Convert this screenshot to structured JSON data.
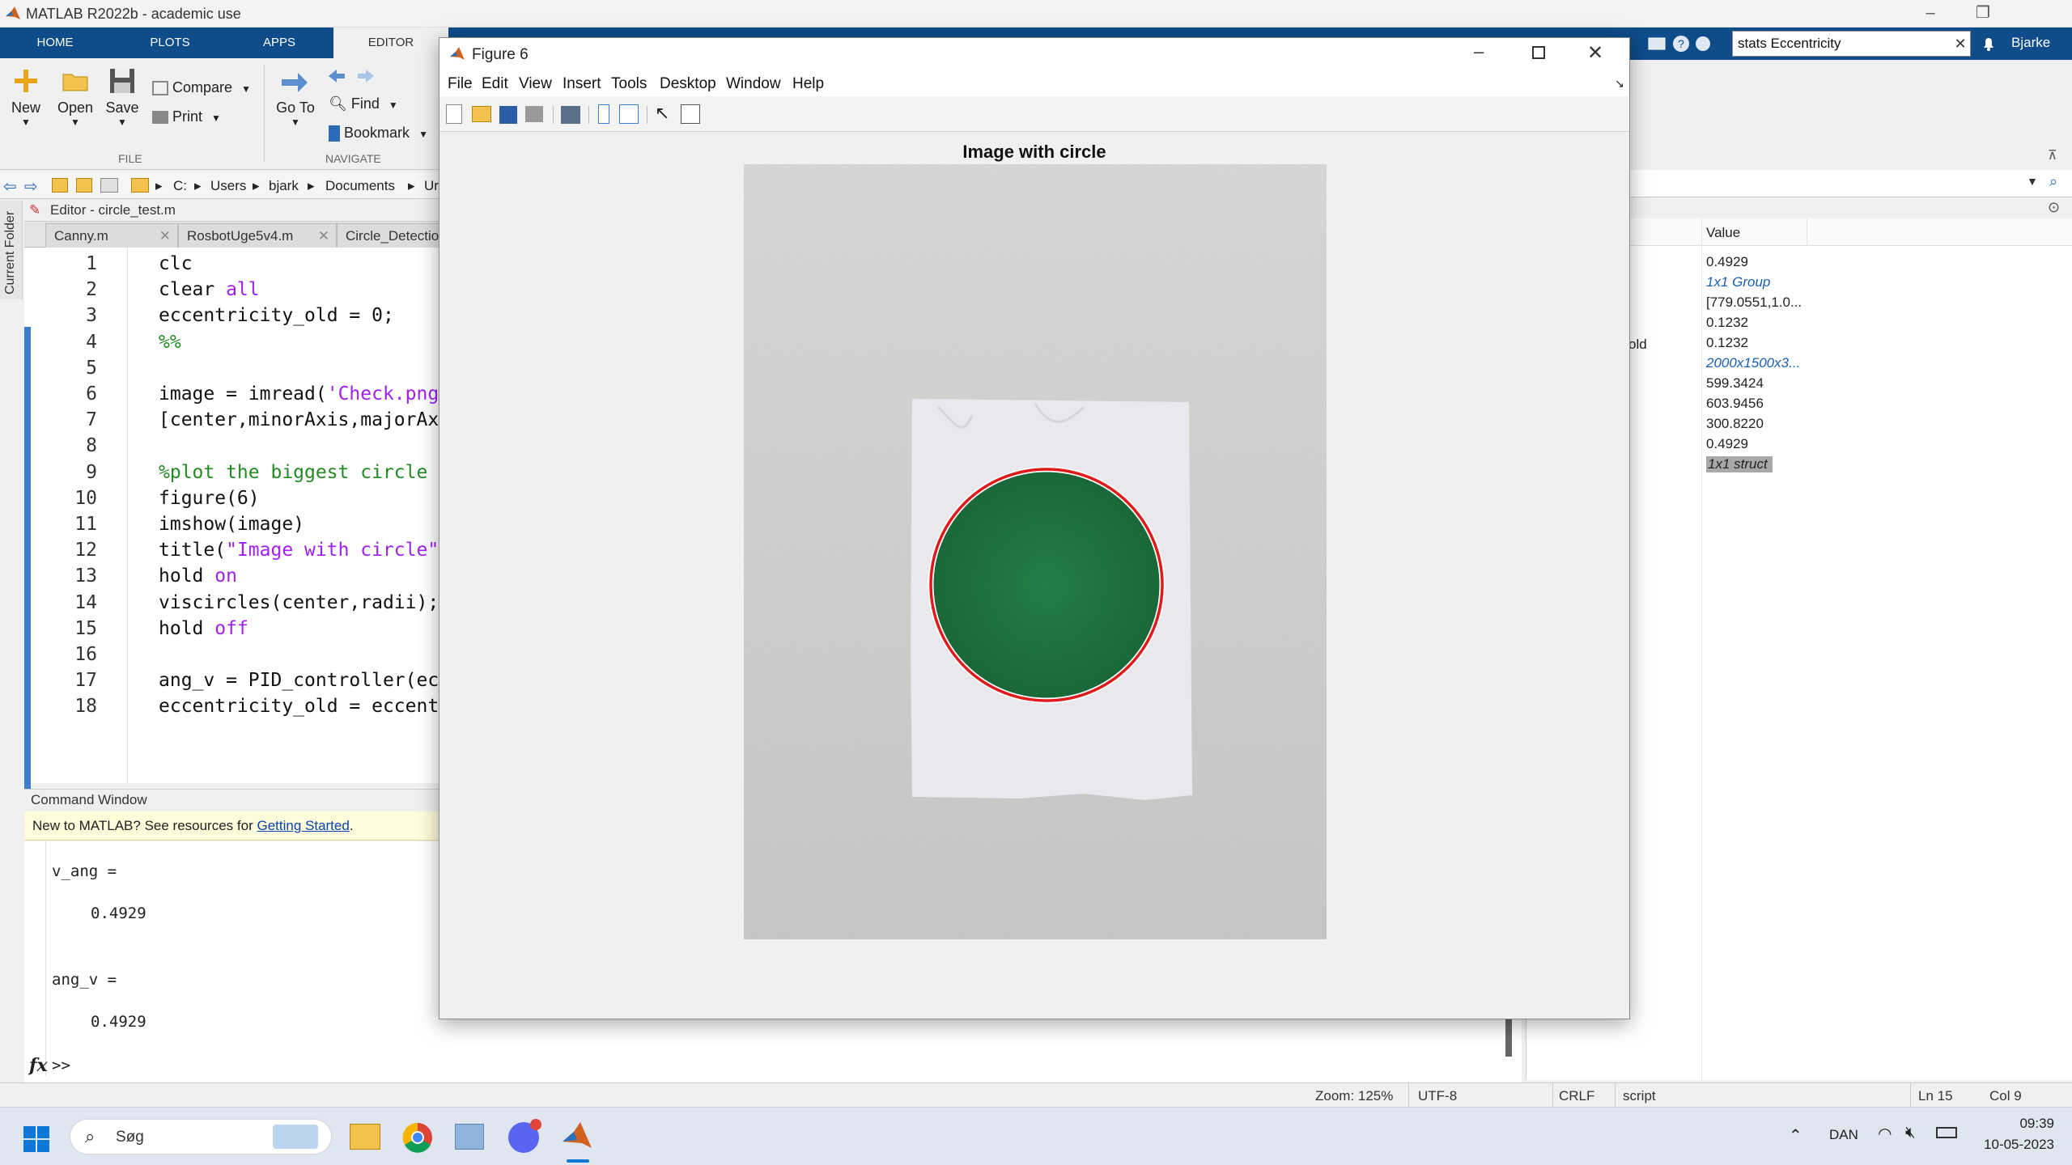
{
  "app": {
    "title": "MATLAB R2022b - academic use",
    "window_controls": [
      "–",
      "❐",
      "✕"
    ]
  },
  "ribbon": {
    "tabs": [
      "HOME",
      "PLOTS",
      "APPS",
      "EDITOR"
    ],
    "active_tab": "EDITOR",
    "file_section": {
      "label": "FILE",
      "new": "New",
      "open": "Open",
      "save": "Save",
      "compare": "Compare",
      "print": "Print"
    },
    "navigate_section": {
      "label": "NAVIGATE",
      "goto": "Go To",
      "find": "Find",
      "bookmark": "Bookmark"
    }
  },
  "search": {
    "value": "stats Eccentricity",
    "user": "Bjarke"
  },
  "address": {
    "crumbs": [
      "C:",
      "Users",
      "bjark",
      "Documents",
      "Ur"
    ]
  },
  "side_tab": {
    "label": "Current Folder"
  },
  "editor": {
    "header": "Editor - circle_test.m",
    "tabs": [
      "Canny.m",
      "RosbotUge5v4.m",
      "Circle_Detection.m"
    ],
    "lines": [
      {
        "n": "1",
        "text": "clc"
      },
      {
        "n": "2",
        "text": "clear ",
        "kw": "all"
      },
      {
        "n": "3",
        "text": "eccentricity_old = 0;"
      },
      {
        "n": "4",
        "cm": "%%"
      },
      {
        "n": "5",
        "text": ""
      },
      {
        "n": "6",
        "text": "image = imread(",
        "str": "'Check.png"
      },
      {
        "n": "7",
        "text": "[center,minorAxis,majorAx:"
      },
      {
        "n": "8",
        "text": ""
      },
      {
        "n": "9",
        "cm": "%plot the biggest circle d"
      },
      {
        "n": "10",
        "text": "figure(6)"
      },
      {
        "n": "11",
        "text": "imshow(image)"
      },
      {
        "n": "12",
        "text": "title(",
        "str": "\"Image with circle\""
      },
      {
        "n": "13",
        "text": "hold ",
        "kw": "on"
      },
      {
        "n": "14",
        "text": "viscircles(center,radii);"
      },
      {
        "n": "15",
        "text": "hold ",
        "kw": "off"
      },
      {
        "n": "16",
        "text": ""
      },
      {
        "n": "17",
        "text": "ang_v = PID_controller(ec("
      },
      {
        "n": "18",
        "text": "eccentricity_old = eccent:"
      }
    ]
  },
  "command_window": {
    "header": "Command Window",
    "notice_prefix": "New to MATLAB? See resources for ",
    "notice_link": "Getting Started",
    "notice_suffix": ".",
    "output": [
      "v_ang =",
      "0.4929",
      "ang_v =",
      "0.4929"
    ],
    "prompt_fx": "fx",
    "prompt": ">>"
  },
  "workspace": {
    "value_header": "Value",
    "partial_name": "old",
    "values": [
      {
        "v": "0.4929",
        "style": "normal"
      },
      {
        "v": "1x1 Group",
        "style": "link"
      },
      {
        "v": "[779.0551,1.0...",
        "style": "normal"
      },
      {
        "v": "0.1232",
        "style": "normal"
      },
      {
        "v": "0.1232",
        "style": "normal"
      },
      {
        "v": "2000x1500x3...",
        "style": "link"
      },
      {
        "v": "599.3424",
        "style": "normal"
      },
      {
        "v": "603.9456",
        "style": "normal"
      },
      {
        "v": "300.8220",
        "style": "normal"
      },
      {
        "v": "0.4929",
        "style": "normal"
      },
      {
        "v": "1x1 struct",
        "style": "selected"
      }
    ]
  },
  "status": {
    "zoom": "Zoom: 125%",
    "encoding": "UTF-8",
    "eol": "CRLF",
    "type": "script",
    "ln": "Ln  15",
    "col": "Col  9"
  },
  "figure": {
    "title": "Figure 6",
    "menu": [
      "File",
      "Edit",
      "View",
      "Insert",
      "Tools",
      "Desktop",
      "Window",
      "Help"
    ],
    "axes_title": "Image with circle"
  },
  "taskbar": {
    "search": "Søg",
    "lang": "DAN",
    "time": "09:39",
    "date": "10-05-2023"
  },
  "colors": {
    "ribbon": "#0e4c8a",
    "circle": "#e01a1a",
    "green": "#1a7a3a"
  }
}
